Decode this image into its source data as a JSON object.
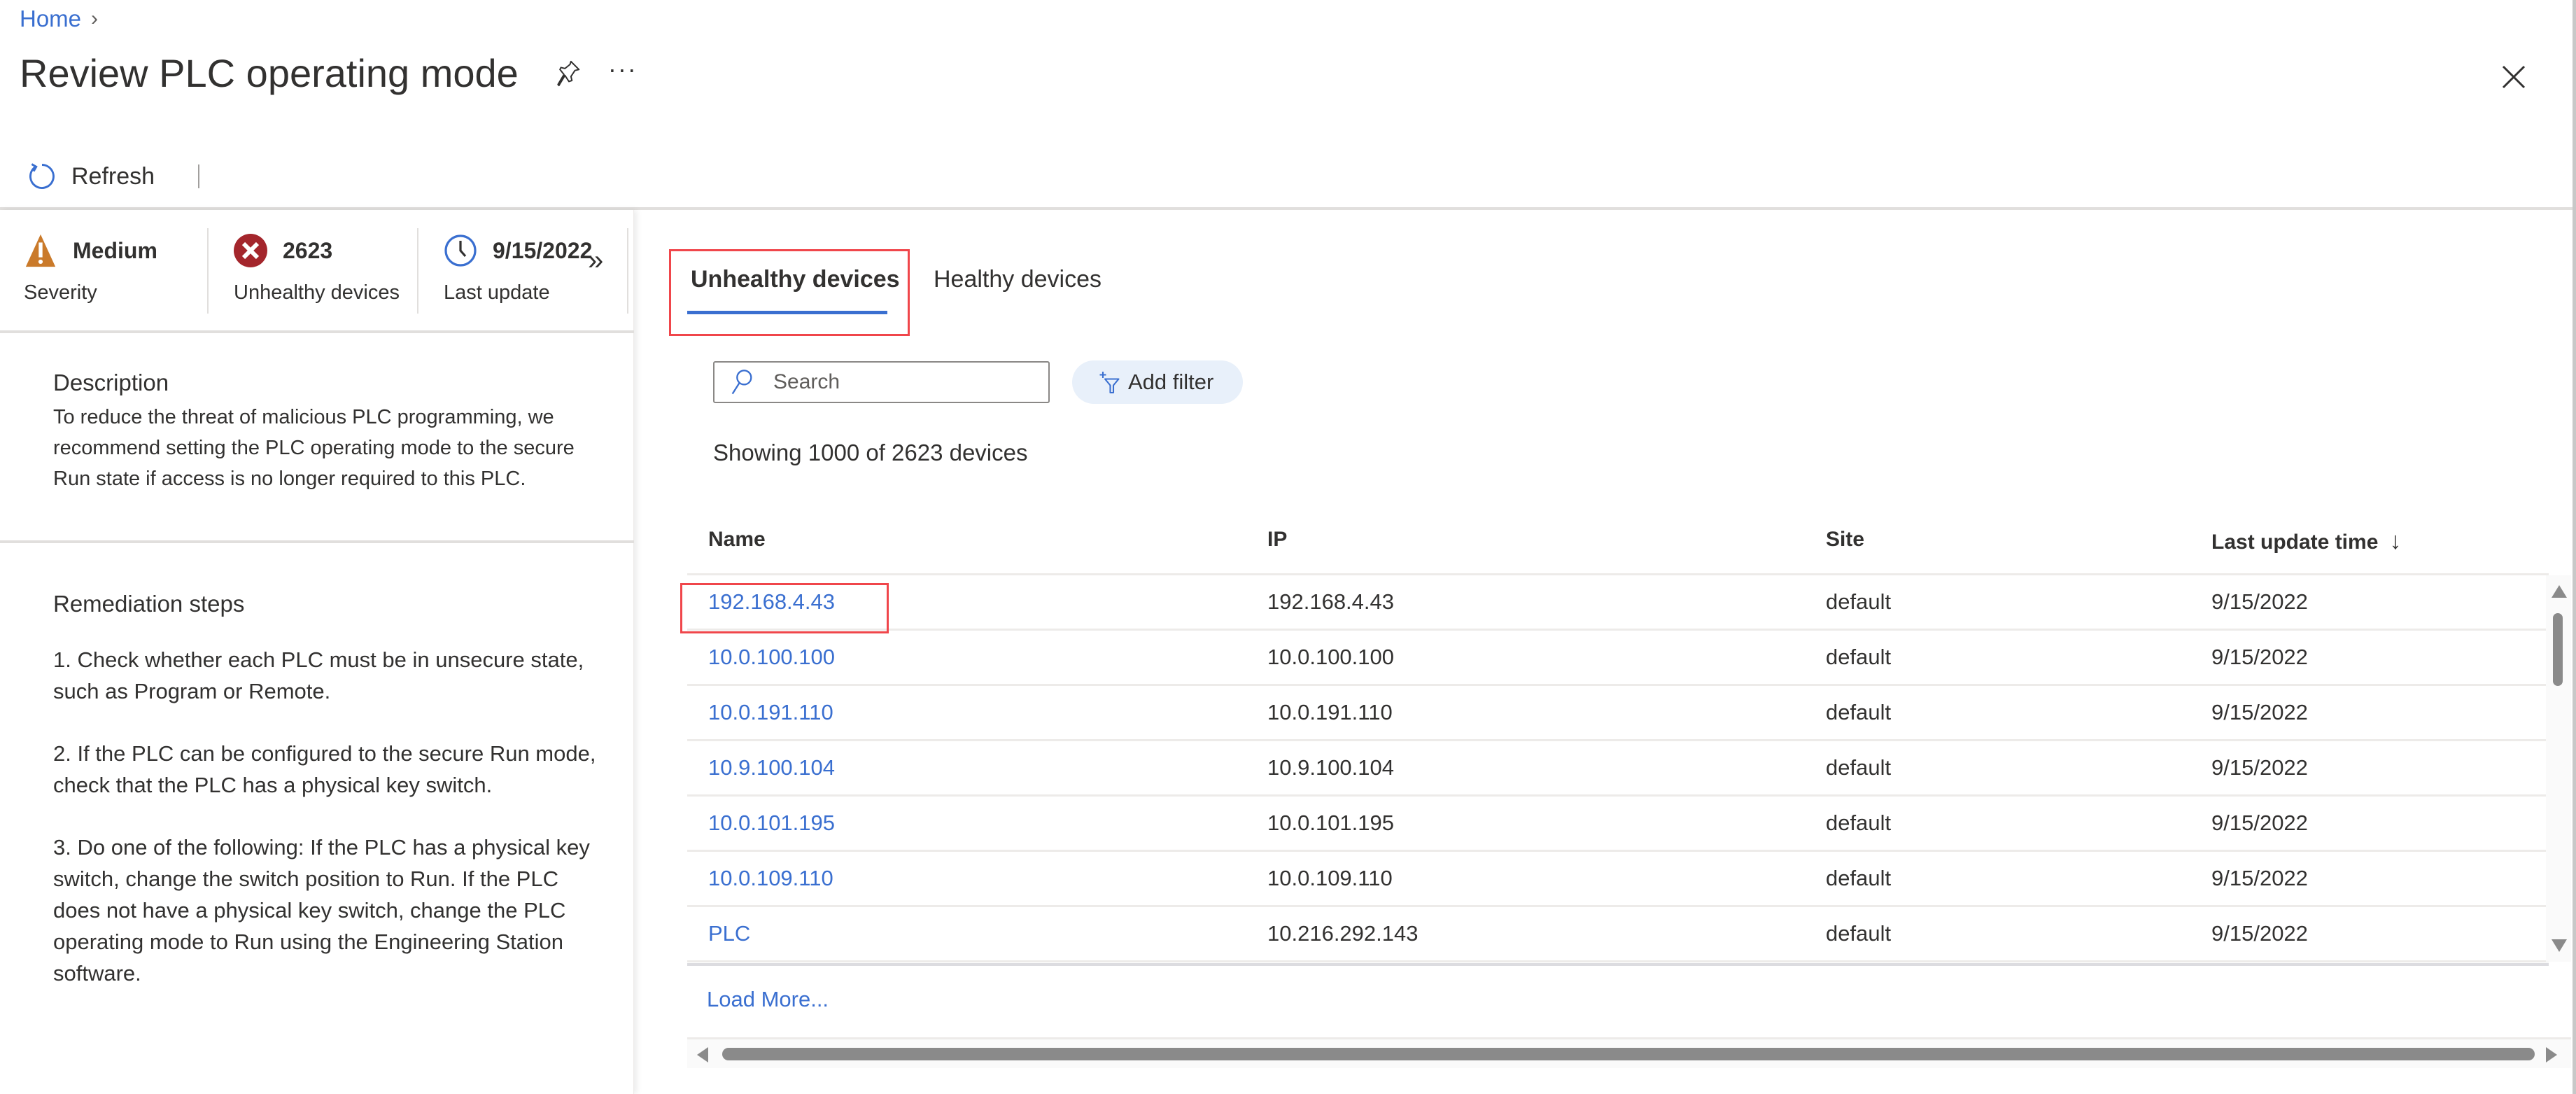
{
  "breadcrumb": {
    "home": "Home",
    "separator": "›"
  },
  "header": {
    "title": "Review PLC operating mode",
    "more": "···"
  },
  "toolbar": {
    "refresh_label": "Refresh"
  },
  "summary": {
    "severity": {
      "value": "Medium",
      "label": "Severity",
      "color": "#ca7a2a"
    },
    "unhealthy": {
      "value": "2623",
      "label": "Unhealthy devices",
      "color": "#a4262c"
    },
    "last_update": {
      "value": "9/15/2022",
      "label": "Last update",
      "color": "#3a6fd0"
    },
    "expand": "»"
  },
  "description": {
    "heading": "Description",
    "body": "To reduce the threat of malicious PLC programming, we recommend setting the PLC operating mode to the secure Run state if access is no longer required to this PLC."
  },
  "remediation": {
    "heading": "Remediation steps",
    "steps": [
      "1. Check whether each PLC must be in unsecure state, such as Program or Remote.",
      "2. If the PLC can be configured to the secure Run mode, check that the PLC has a physical key switch.",
      "3. Do one of the following: If the PLC has a physical key switch, change the switch position to Run. If the PLC does not have a physical key switch, change the PLC operating mode to Run using the Engineering Station software."
    ]
  },
  "tabs": [
    {
      "label": "Unhealthy devices",
      "active": true
    },
    {
      "label": "Healthy devices",
      "active": false
    }
  ],
  "search": {
    "placeholder": "Search",
    "value": ""
  },
  "filter": {
    "label": "Add filter"
  },
  "showing": "Showing 1000 of 2623 devices",
  "table": {
    "columns": [
      "Name",
      "IP",
      "Site",
      "Last update time"
    ],
    "sort_indicator": "↓",
    "rows": [
      {
        "name": "192.168.4.43",
        "ip": "192.168.4.43",
        "site": "default",
        "time": "9/15/2022"
      },
      {
        "name": "10.0.100.100",
        "ip": "10.0.100.100",
        "site": "default",
        "time": "9/15/2022"
      },
      {
        "name": "10.0.191.110",
        "ip": "10.0.191.110",
        "site": "default",
        "time": "9/15/2022"
      },
      {
        "name": "10.9.100.104",
        "ip": "10.9.100.104",
        "site": "default",
        "time": "9/15/2022"
      },
      {
        "name": "10.0.101.195",
        "ip": "10.0.101.195",
        "site": "default",
        "time": "9/15/2022"
      },
      {
        "name": "10.0.109.110",
        "ip": "10.0.109.110",
        "site": "default",
        "time": "9/15/2022"
      },
      {
        "name": "PLC",
        "ip": "10.216.292.143",
        "site": "default",
        "time": "9/15/2022"
      }
    ],
    "load_more": "Load More..."
  },
  "colors": {
    "accent": "#3a6fd0",
    "highlight": "#f0464b",
    "link": "#3a6fd0"
  }
}
